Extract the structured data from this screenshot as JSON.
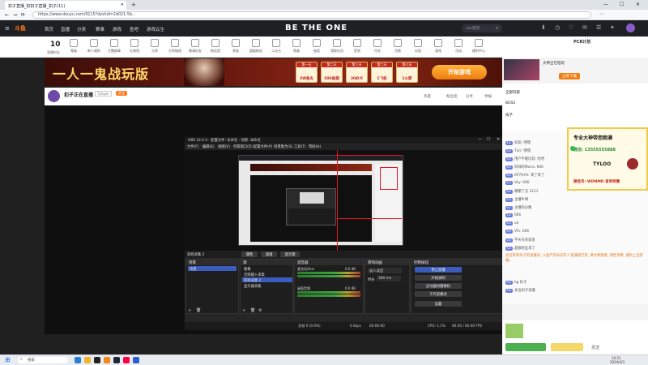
{
  "browser": {
    "tab_title": "扣子直播_扣扣子直播_扣子(11)",
    "url": "https://www.douyu.com/9115?dyshid=2d021-5b...",
    "new_tab": "+"
  },
  "site_nav": {
    "logo": "斗鱼",
    "items": [
      "首页",
      "直播",
      "分类",
      "赛事",
      "游戏",
      "鱼吧",
      "游戏云生"
    ],
    "center_title": "BE THE ONE",
    "search_placeholder": "xxx游戏"
  },
  "func_bar": {
    "level": "10",
    "level_label": "直播时长",
    "items": [
      "直播时长",
      "等级",
      "新人福利",
      "主播勋章",
      "礼物墙",
      "分享",
      "分享链接",
      "邀请好友",
      "粉丝团",
      "贵族",
      "超级粉丝",
      "二次元",
      "等级",
      "抽奖",
      "领取礼包",
      "签到",
      "任务",
      "兑换",
      "对战",
      "游戏",
      "活动",
      "福利中心",
      "上下翻页",
      "主播"
    ]
  },
  "banner": {
    "title": "一人一鬼战玩版",
    "gifts": [
      {
        "day": "第一天",
        "reward": "2W鱼丸"
      },
      {
        "day": "第二天",
        "reward": "500鱼翅"
      },
      {
        "day": "第三天",
        "reward": "30办卡"
      },
      {
        "day": "第六天",
        "reward": "1飞机"
      },
      {
        "day": "第七天",
        "reward": "1火箭"
      }
    ],
    "cta": "开始游戏"
  },
  "room": {
    "name": "扣子正在直播",
    "tag": "Tpligan",
    "follow": "关注",
    "stats": [
      "热度",
      "粉丝团",
      "分享",
      "举报"
    ]
  },
  "obs": {
    "title": "OBS 32.0.4 - 配置文件: 未命名 - 场景: 未命名",
    "menu": [
      "文件(F)",
      "编辑(E)",
      "视图(V)",
      "停靠窗口(D)",
      "配置文件(P)",
      "场景集合(S)",
      "工具(T)",
      "帮助(H)"
    ],
    "source_label": "游戏采集 2",
    "toolbar": [
      "属性",
      "滤镜",
      "显示源"
    ],
    "panels": {
      "scenes": "场景",
      "sources": "源",
      "mixer": "混音器",
      "transitions": "转场动画",
      "controls": "控制按钮"
    },
    "scenes": [
      "场景"
    ],
    "sources": [
      "图像",
      "音频输入采集",
      "游戏采集 2",
      "显示器采集"
    ],
    "mixer": [
      {
        "name": "麦克风/Aux",
        "db": "0.0 dB"
      },
      {
        "name": "桌面音频",
        "db": "0.0 dB"
      }
    ],
    "transition": {
      "type": "淡入淡出",
      "duration_label": "时长",
      "duration": "300 ms"
    },
    "controls": [
      "停止直播",
      "开始录制",
      "启动虚拟摄像机",
      "工作室模式",
      "设置"
    ],
    "status": {
      "dropped": "丢帧 0 (0.0%)",
      "kbps": "0 kbps",
      "cpu": "CPU: 1.1%",
      "fps": "60.00 / 60.00 FPS",
      "time": "00:00:00"
    }
  },
  "overlay": {
    "line1": "专业大神带您跑满",
    "line2": "微信: 13555555888",
    "line3": "TYLOO",
    "line4": "微信号: WDNMD 首单特惠"
  },
  "right": {
    "top_title": "大神正在陪玩",
    "top_btn": "立即下载",
    "chat_header": "PCB计划",
    "ranking": [
      "全部玩家",
      "BOSS",
      "扣子"
    ],
    "messages": [
      "扣扣: 嘿嘿",
      "Tvtr: 嘿嘿",
      "用户不能比较: 哈哈",
      "科帅的Mario: 666",
      "KP7HYH: 来了来了",
      "Vay: 666",
      "嘟嘟了没 2121",
      "主播牛啊",
      "主播的分数",
      "666",
      "ok",
      "Vfn: 666",
      "不天天的家里",
      "超级粉丝来了",
      "上帝请给我",
      "加油"
    ],
    "notice": "欢迎来到扣子的直播间, 斗鱼严禁未成年人直播或打赏, 请文明观看, 理性消费, 谨防上当受骗。",
    "enter_msg": "bg 扣子",
    "enter_msg2": "关注扣子直播",
    "send": "发送"
  },
  "taskbar": {
    "search": "搜索",
    "time": "10:21",
    "date": "2024/4/3"
  }
}
